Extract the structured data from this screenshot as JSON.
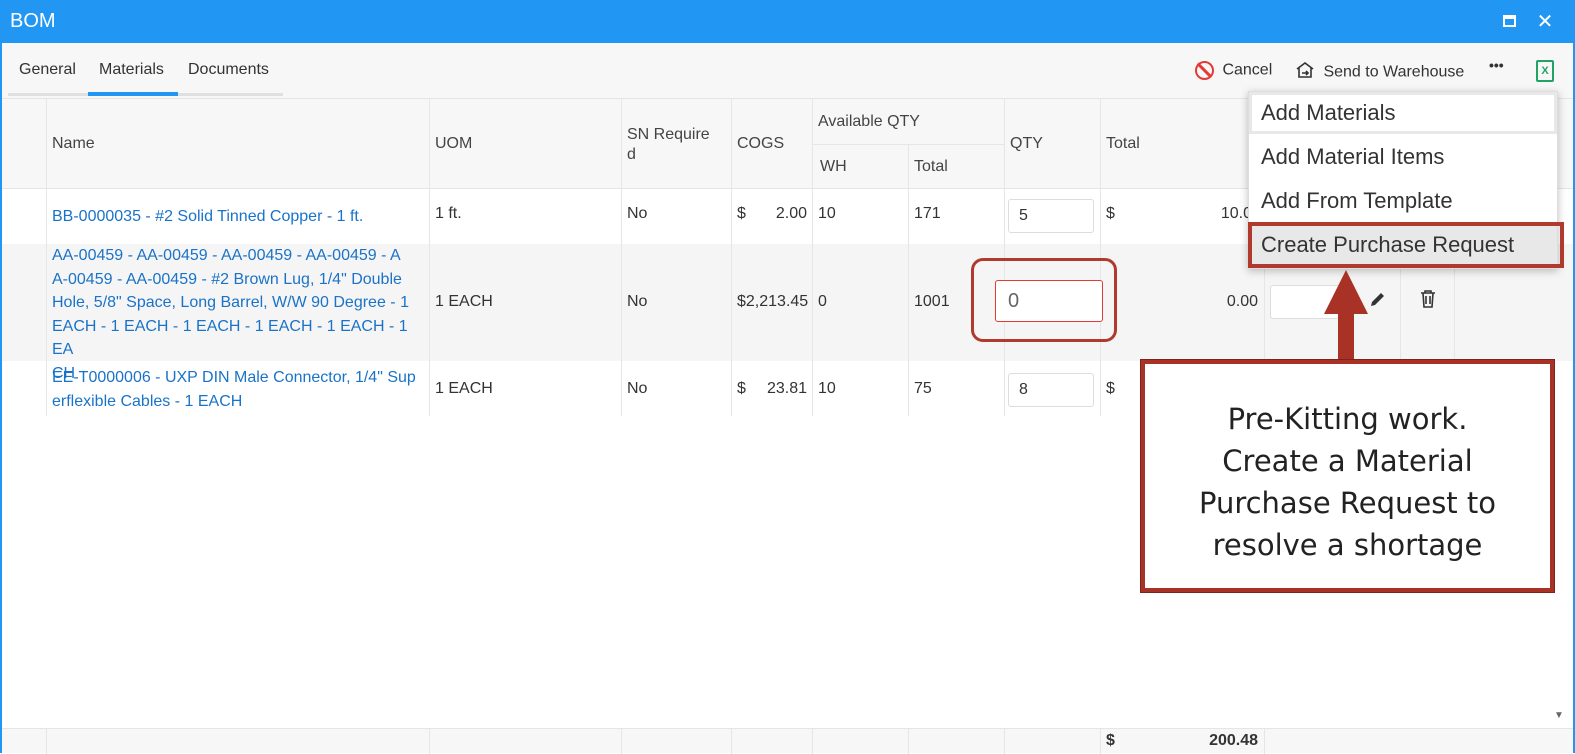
{
  "window": {
    "title": "BOM"
  },
  "tabs": [
    {
      "label": "General"
    },
    {
      "label": "Materials"
    },
    {
      "label": "Documents"
    }
  ],
  "toolbar": {
    "cancel_label": "Cancel",
    "send_label": "Send to Warehouse",
    "more_label": "•••",
    "excel_label": "X"
  },
  "columns": {
    "name": "Name",
    "uom": "UOM",
    "sn_required": "SN Require\nd",
    "cogs": "COGS",
    "available_qty": "Available QTY",
    "wh": "WH",
    "total_available": "Total",
    "qty": "QTY",
    "total": "Total"
  },
  "rows": [
    {
      "name": "BB-0000035 - #2 Solid Tinned Copper - 1 ft.",
      "uom": "1 ft.",
      "sn": "No",
      "cogs_symbol": "$",
      "cogs_value": "2.00",
      "wh": "10",
      "available_total": "171",
      "qty": "5",
      "total_symbol": "$",
      "total_value": "10.0"
    },
    {
      "name": "AA-00459 - AA-00459 - AA-00459 - AA-00459 - A\nA-00459 - AA-00459 - #2 Brown Lug, 1/4\" Double\nHole, 5/8\" Space, Long Barrel, W/W 90 Degree - 1\nEACH - 1 EACH - 1 EACH - 1 EACH - 1 EACH - 1 EA\nCH",
      "uom": "1 EACH",
      "sn": "No",
      "cogs_symbol": "",
      "cogs_value": "$2,213.45",
      "wh": "0",
      "available_total": "1001",
      "qty": "0",
      "total_symbol": "",
      "total_value": "0.00"
    },
    {
      "name": "EE-T0000006 - UXP DIN Male Connector, 1/4\" Sup\nerflexible Cables - 1 EACH",
      "uom": "1 EACH",
      "sn": "No",
      "cogs_symbol": "$",
      "cogs_value": "23.81",
      "wh": "10",
      "available_total": "75",
      "qty": "8",
      "total_symbol": "$",
      "total_value": ""
    }
  ],
  "footer": {
    "total_symbol": "$",
    "total_value": "200.48"
  },
  "dropdown": {
    "items": [
      {
        "label": "Add Materials"
      },
      {
        "label": "Add Material Items"
      },
      {
        "label": "Add From Template"
      },
      {
        "label": "Create Purchase Request"
      }
    ]
  },
  "callout": {
    "text": "Pre-Kitting work.\nCreate a Material\nPurchase Request to\nresolve a shortage"
  },
  "colors": {
    "accent": "#2196f3",
    "link": "#1a73c8",
    "error": "#e53935",
    "callout_border": "#a93226"
  }
}
